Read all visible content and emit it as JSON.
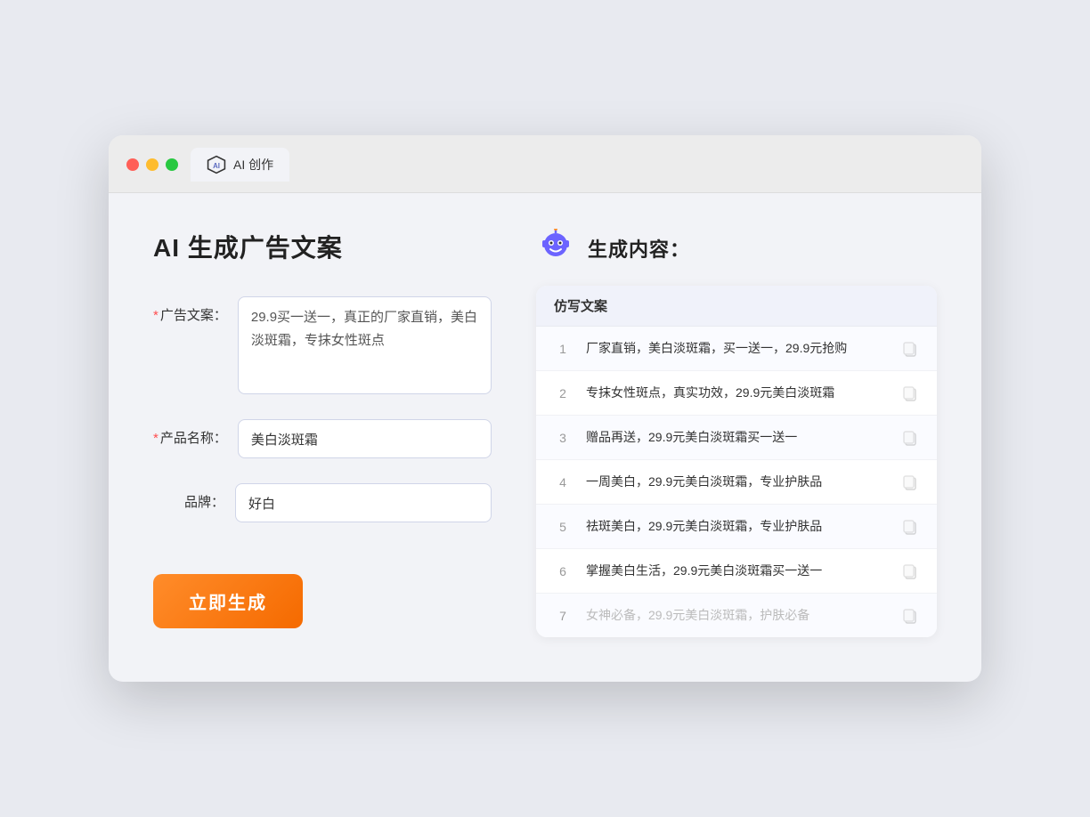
{
  "browser": {
    "tab_label": "AI 创作"
  },
  "page": {
    "title": "AI 生成广告文案",
    "result_title": "生成内容："
  },
  "form": {
    "ad_copy_label": "广告文案：",
    "ad_copy_required": true,
    "ad_copy_value": "29.9买一送一，真正的厂家直销，美白淡斑霜，专抹女性斑点",
    "product_name_label": "产品名称：",
    "product_name_required": true,
    "product_name_value": "美白淡斑霜",
    "brand_label": "品牌：",
    "brand_required": false,
    "brand_value": "好白",
    "generate_btn": "立即生成"
  },
  "table": {
    "header": "仿写文案",
    "rows": [
      {
        "num": "1",
        "text": "厂家直销，美白淡斑霜，买一送一，29.9元抢购",
        "faded": false
      },
      {
        "num": "2",
        "text": "专抹女性斑点，真实功效，29.9元美白淡斑霜",
        "faded": false
      },
      {
        "num": "3",
        "text": "赠品再送，29.9元美白淡斑霜买一送一",
        "faded": false
      },
      {
        "num": "4",
        "text": "一周美白，29.9元美白淡斑霜，专业护肤品",
        "faded": false
      },
      {
        "num": "5",
        "text": "祛斑美白，29.9元美白淡斑霜，专业护肤品",
        "faded": false
      },
      {
        "num": "6",
        "text": "掌握美白生活，29.9元美白淡斑霜买一送一",
        "faded": false
      },
      {
        "num": "7",
        "text": "女神必备，29.9元美白淡斑霜，护肤必备",
        "faded": true
      }
    ]
  }
}
